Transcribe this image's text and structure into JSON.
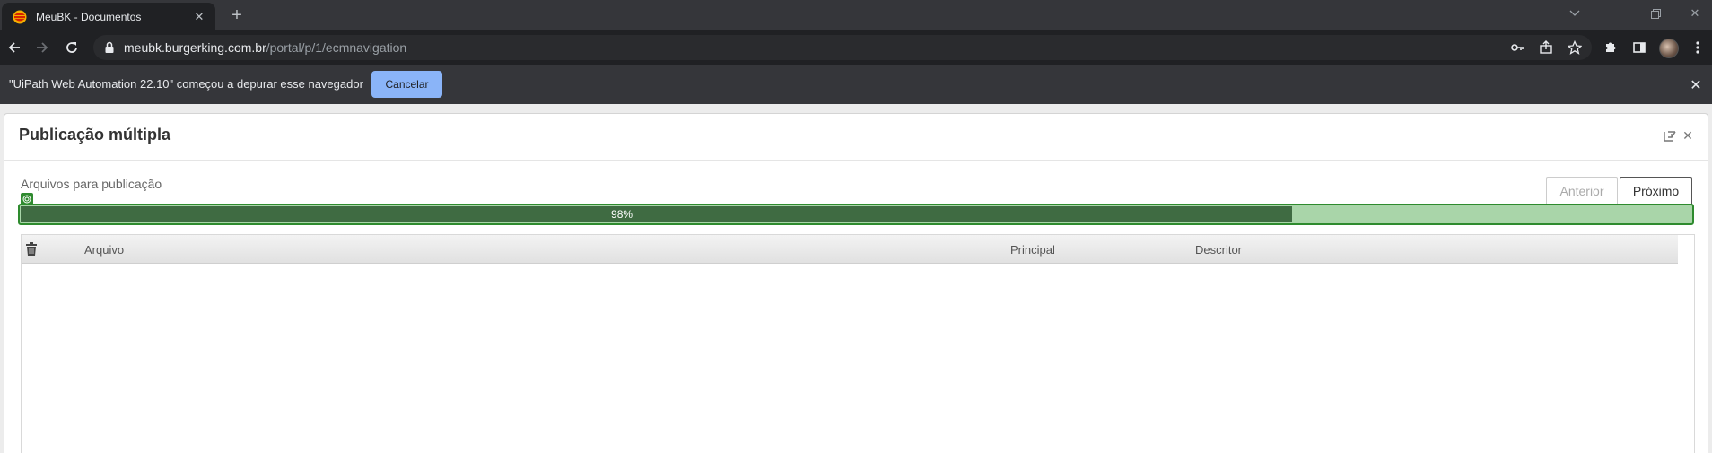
{
  "browser": {
    "tab_title": "MeuBK - Documentos",
    "url_host": "meubk.burgerking.com.br",
    "url_path": "/portal/p/1/ecmnavigation"
  },
  "infobar": {
    "message": "\"UiPath Web Automation 22.10\" começou a depurar esse navegador",
    "cancel_label": "Cancelar"
  },
  "modal": {
    "title": "Publicação múltipla",
    "upload_label": "Arquivos para publicação",
    "prev_label": "Anterior",
    "next_label": "Próximo",
    "progress_text": "98%",
    "progress_fill_fraction": 0.76,
    "columns": [
      "Arquivo",
      "Principal",
      "Descritor"
    ]
  },
  "colors": {
    "progress_border": "#2e8b2e",
    "progress_fill": "#3f6b42",
    "progress_track": "#a9d5a9",
    "infobar_button": "#8ab4f8"
  }
}
